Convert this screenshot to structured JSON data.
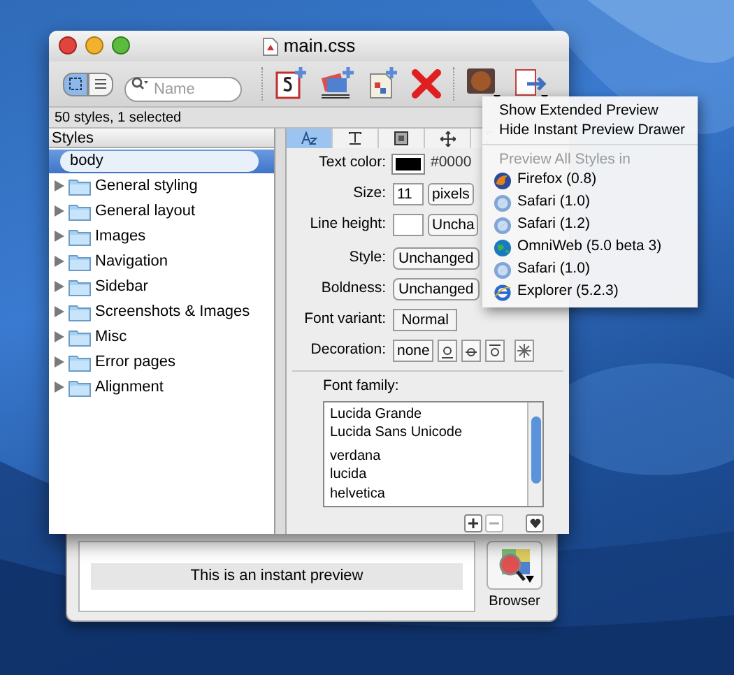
{
  "window": {
    "title": "main.css"
  },
  "toolbar": {
    "view_modes": [
      {
        "kind": "icons",
        "selected": true
      },
      {
        "kind": "list",
        "selected": false
      }
    ],
    "search": {
      "placeholder": "Name"
    }
  },
  "status": "50 styles, 1 selected",
  "sidebar": {
    "header": "Styles",
    "items": [
      {
        "label": "body",
        "kind": "style",
        "selected": true
      },
      {
        "label": "General styling",
        "kind": "folder",
        "selected": false
      },
      {
        "label": "General layout",
        "kind": "folder",
        "selected": false
      },
      {
        "label": "Images",
        "kind": "folder",
        "selected": false
      },
      {
        "label": "Navigation",
        "kind": "folder",
        "selected": false
      },
      {
        "label": "Sidebar",
        "kind": "folder",
        "selected": false
      },
      {
        "label": "Screenshots & Images",
        "kind": "folder",
        "selected": false
      },
      {
        "label": "Misc",
        "kind": "folder",
        "selected": false
      },
      {
        "label": "Error pages",
        "kind": "folder",
        "selected": false
      },
      {
        "label": "Alignment",
        "kind": "folder",
        "selected": false
      }
    ]
  },
  "inspector": {
    "tabs": [
      {
        "kind": "text",
        "selected": true
      },
      {
        "kind": "paragraph",
        "selected": false
      },
      {
        "kind": "background",
        "selected": false
      },
      {
        "kind": "position",
        "selected": false
      },
      {
        "kind": "box",
        "selected": false
      }
    ],
    "text_color": {
      "label": "Text color:",
      "value": "#0000"
    },
    "size": {
      "label": "Size:",
      "value": "11",
      "unit": "pixels"
    },
    "line_height": {
      "label": "Line height:",
      "unit": "Uncha"
    },
    "style": {
      "label": "Style:",
      "value": "Unchanged"
    },
    "boldness": {
      "label": "Boldness:",
      "value": "Unchanged"
    },
    "font_variant": {
      "label": "Font variant:",
      "option": "Normal"
    },
    "decoration": {
      "label": "Decoration:",
      "options": [
        {
          "kind": "none",
          "label": "none",
          "selected": false
        },
        {
          "kind": "underline",
          "selected": false
        },
        {
          "kind": "strikethrough",
          "selected": false
        },
        {
          "kind": "overline",
          "selected": false
        },
        {
          "kind": "blink",
          "selected": false
        }
      ]
    },
    "font_family": {
      "label": "Font family:",
      "items": [
        "Lucida Grande",
        "Lucida Sans Unicode",
        "verdana",
        "lucida",
        "helvetica"
      ]
    }
  },
  "drawer": {
    "preview": "This is an instant preview",
    "browser_button": "Browser"
  },
  "menu": {
    "items": [
      {
        "kind": "item",
        "label": "Show Extended Preview"
      },
      {
        "kind": "item",
        "label": "Hide Instant Preview Drawer"
      },
      {
        "kind": "separator"
      },
      {
        "kind": "header",
        "label": "Preview All Styles in"
      },
      {
        "kind": "firefox",
        "label": "Firefox (0.8)"
      },
      {
        "kind": "safari",
        "label": "Safari (1.0)"
      },
      {
        "kind": "safari",
        "label": "Safari (1.2)"
      },
      {
        "kind": "omniweb",
        "label": "OmniWeb (5.0 beta 3)"
      },
      {
        "kind": "safari",
        "label": "Safari (1.0)"
      },
      {
        "kind": "explorer",
        "label": "Explorer (5.2.3)"
      }
    ]
  }
}
